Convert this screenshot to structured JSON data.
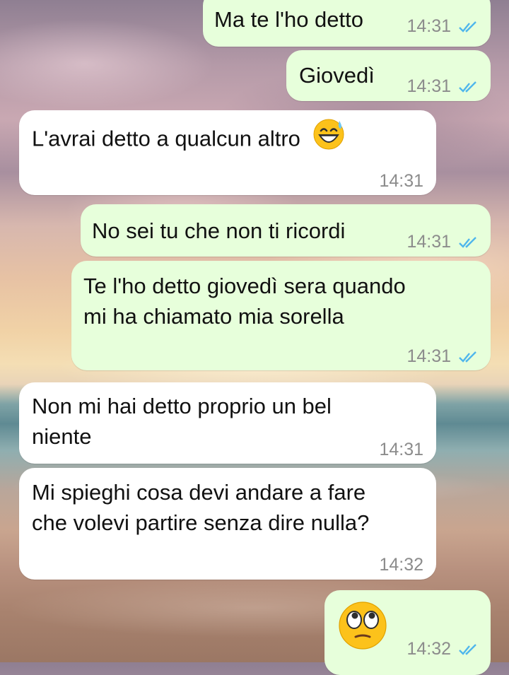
{
  "chat": {
    "messages": [
      {
        "direction": "out",
        "text": "Ma te l'ho detto",
        "time": "14:31",
        "status": "read"
      },
      {
        "direction": "out",
        "text": "Giovedì",
        "time": "14:31",
        "status": "read"
      },
      {
        "direction": "in",
        "text": "L'avrai detto a qualcun altro",
        "emoji": "grinning-sweat",
        "time": "14:31"
      },
      {
        "direction": "out",
        "text": "No sei tu che non ti ricordi",
        "time": "14:31",
        "status": "read"
      },
      {
        "direction": "out",
        "lines": [
          "Te l'ho detto giovedì sera quando",
          "mi ha chiamato mia sorella"
        ],
        "time": "14:31",
        "status": "read"
      },
      {
        "direction": "in",
        "lines": [
          "Non mi hai detto proprio un bel",
          "niente"
        ],
        "time": "14:31"
      },
      {
        "direction": "in",
        "lines": [
          "Mi spieghi cosa devi andare a fare",
          "che volevi partire senza dire nulla?"
        ],
        "time": "14:32"
      },
      {
        "direction": "out",
        "emoji": "rolling-eyes",
        "time": "14:32",
        "status": "read"
      }
    ]
  },
  "colors": {
    "outgoing_bubble": "#e7ffdb",
    "incoming_bubble": "#ffffff",
    "read_ticks": "#4fb6ec",
    "timestamp": "#8c8c8c"
  }
}
